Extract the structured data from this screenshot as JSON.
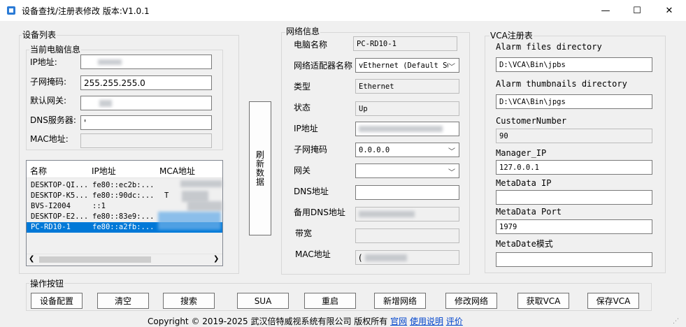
{
  "window": {
    "title": "设备查找/注册表修改 版本:V1.0.1",
    "min_label": "—",
    "max_label": "☐",
    "close_label": "✕"
  },
  "device_list": {
    "group_label": "设备列表",
    "current_pc": {
      "group_label": "当前电脑信息",
      "ip_label": "IP地址:",
      "subnet_label": "子网掩码:",
      "subnet_value": "255.255.255.0",
      "gateway_label": "默认网关:",
      "dns_label": "DNS服务器:",
      "dns_value": "'",
      "mac_label": "MAC地址:"
    },
    "table": {
      "columns": [
        "名称",
        "IP地址",
        "MCA地址"
      ],
      "rows": [
        {
          "name": "DESKTOP-QI...",
          "ip": "fe80::ec2b:...",
          "mac": ""
        },
        {
          "name": "DESKTOP-K5...",
          "ip": "fe80::90dc:...",
          "mac": "T"
        },
        {
          "name": "BVS-I2004",
          "ip": "::1",
          "mac": ""
        },
        {
          "name": "DESKTOP-E2...",
          "ip": "fe80::83e9:...",
          "mac": ""
        },
        {
          "name": "PC-RD10-1",
          "ip": "fe80::a2fb:...",
          "mac": ""
        }
      ],
      "selected_index": 4
    }
  },
  "refresh_button": "刷新数据",
  "network": {
    "group_label": "网络信息",
    "pc_name_label": "电脑名称",
    "pc_name_value": "PC-RD10-1",
    "adapter_label": "网络适配器名称",
    "adapter_value": "vEthernet (Default Sw",
    "type_label": "类型",
    "type_value": "Ethernet",
    "status_label": "状态",
    "status_value": "Up",
    "ip_label": "IP地址",
    "subnet_label": "子网掩码",
    "subnet_value": "0.0.0.0",
    "gateway_label": "网关",
    "dns_label": "DNS地址",
    "alt_dns_label": "备用DNS地址",
    "bandwidth_label": "带宽",
    "mac_label": "MAC地址",
    "mac_value": "("
  },
  "vca": {
    "group_label": "VCA注册表",
    "alarm_files_label": "Alarm files directory",
    "alarm_files_value": "D:\\VCA\\Bin\\jpbs",
    "alarm_thumbs_label": "Alarm thumbnails directory",
    "alarm_thumbs_value": "D:\\VCA\\Bin\\jpgs",
    "customer_label": "CustomerNumber",
    "customer_value": "90",
    "manager_ip_label": "Manager_IP",
    "manager_ip_value": "127.0.0.1",
    "metadata_ip_label": "MetaData IP",
    "metadata_ip_value": "",
    "metadata_port_label": "MetaData Port",
    "metadata_port_value": "1979",
    "metadata_mode_label": "MetaDate模式",
    "metadata_mode_value": ""
  },
  "actions": {
    "group_label": "操作按钮",
    "device_config": "设备配置",
    "clear": "清空",
    "search": "搜索",
    "sua": "SUA",
    "restart": "重启",
    "add_network": "新增网络",
    "modify_network": "修改网络",
    "get_vca": "获取VCA",
    "save_vca": "保存VCA"
  },
  "footer": {
    "copyright": "Copyright © 2019-2025 武汉倍特威视系统有限公司 版权所有",
    "website": "官网",
    "manual": "使用说明",
    "rate": "评价"
  }
}
